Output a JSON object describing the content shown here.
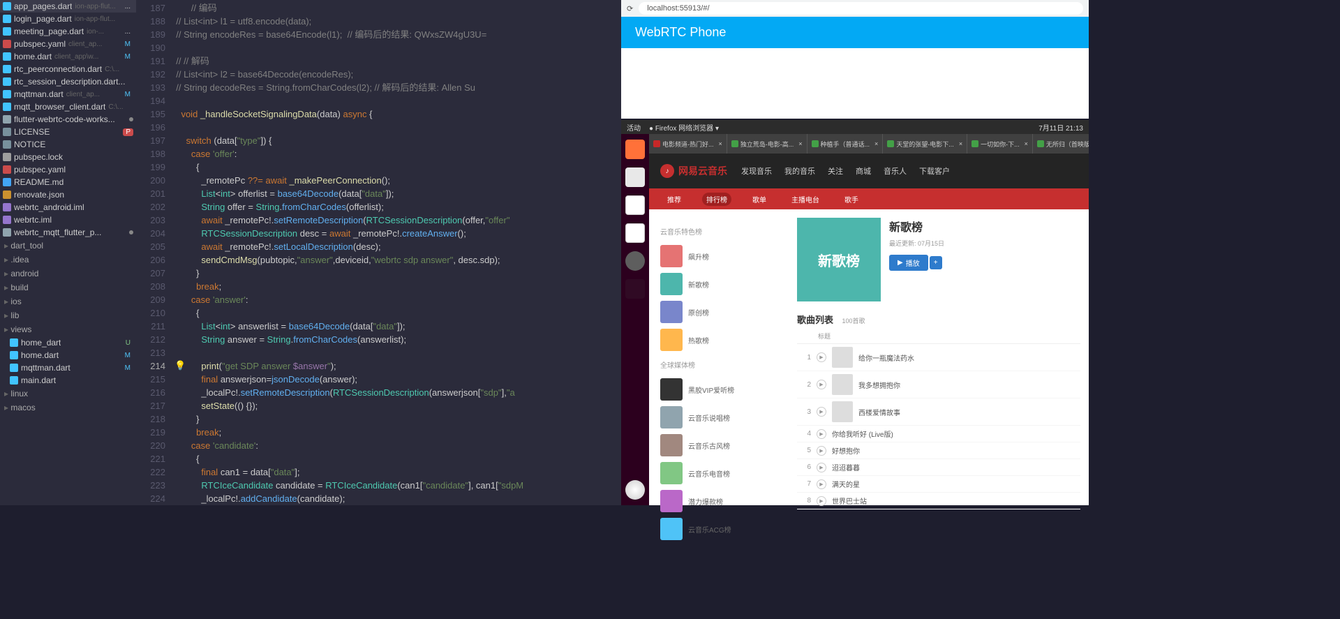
{
  "ide": {
    "files": [
      {
        "name": "app_pages.dart",
        "path": "ion-app-flut...",
        "icon": "dart",
        "badge": "..."
      },
      {
        "name": "login_page.dart",
        "path": "ion-app-flut...",
        "icon": "dart",
        "badge": ""
      },
      {
        "name": "meeting_page.dart",
        "path": "ion-...",
        "icon": "dart",
        "badge": "..."
      },
      {
        "name": "pubspec.yaml",
        "path": "client_ap...",
        "icon": "yaml",
        "badge": "M"
      },
      {
        "name": "home.dart",
        "path": "client_app\\w...",
        "icon": "dart",
        "badge": "M"
      },
      {
        "name": "rtc_peerconnection.dart",
        "path": "C:\\...",
        "icon": "dart",
        "badge": ""
      },
      {
        "name": "rtc_session_description.dart...",
        "path": "",
        "icon": "dart",
        "badge": ""
      },
      {
        "name": "mqttman.dart",
        "path": "client_ap...",
        "icon": "dart",
        "badge": "M"
      },
      {
        "name": "mqtt_browser_client.dart",
        "path": "C:\\...",
        "icon": "dart",
        "badge": ""
      }
    ],
    "project_files": [
      {
        "name": "flutter-webrtc-code-works...",
        "icon": "folder",
        "dot": true
      },
      {
        "name": "LICENSE",
        "icon": "txt",
        "badge": "P"
      },
      {
        "name": "NOTICE",
        "icon": "txt"
      },
      {
        "name": "pubspec.lock",
        "icon": "lock"
      },
      {
        "name": "pubspec.yaml",
        "icon": "yaml"
      },
      {
        "name": "README.md",
        "icon": "md"
      },
      {
        "name": "renovate.json",
        "icon": "json"
      },
      {
        "name": "webrtc_android.iml",
        "icon": "iml"
      },
      {
        "name": "webrtc.iml",
        "icon": "iml"
      },
      {
        "name": "webrtc_mqtt_flutter_p...",
        "icon": "folder",
        "dot": true
      }
    ],
    "folders": [
      "dart_tool",
      ".idea",
      "android",
      "build",
      "ios",
      "lib",
      "views"
    ],
    "lib_files": [
      {
        "name": "home_dart",
        "badge": "U"
      },
      {
        "name": "home.dart",
        "badge": "M"
      },
      {
        "name": "mqttman.dart",
        "badge": "M"
      },
      {
        "name": "main.dart",
        "badge": ""
      }
    ],
    "bottom_folders": [
      "linux",
      "macos"
    ],
    "line_start": 187,
    "highlighted_line": 214,
    "code_lines": [
      {
        "n": 187,
        "html": "        <span class='c'>// 编码</span>"
      },
      {
        "n": 188,
        "html": "  <span class='c'>// List&lt;int&gt; l1 = utf8.encode(data);</span>"
      },
      {
        "n": 189,
        "html": "  <span class='c'>// String encodeRes = base64Encode(l1);  // 编码后的结果: QWxsZW4gU3U=</span>"
      },
      {
        "n": 190,
        "html": ""
      },
      {
        "n": 191,
        "html": "  <span class='c'>// // 解码</span>"
      },
      {
        "n": 192,
        "html": "  <span class='c'>// List&lt;int&gt; l2 = base64Decode(encodeRes);</span>"
      },
      {
        "n": 193,
        "html": "  <span class='c'>// String decodeRes = String.fromCharCodes(l2); // 解码后的结果: Allen Su</span>"
      },
      {
        "n": 194,
        "html": ""
      },
      {
        "n": 195,
        "html": "    <span class='k'>void</span> <span class='fn'>_handleSocketSignalingData</span>(data) <span class='k'>async</span> {"
      },
      {
        "n": 196,
        "html": ""
      },
      {
        "n": 197,
        "html": "      <span class='k'>switch</span> (data[<span class='s'>\"type\"</span>]) {"
      },
      {
        "n": 198,
        "html": "        <span class='k'>case</span> <span class='s'>'offer'</span>:"
      },
      {
        "n": 199,
        "html": "          {"
      },
      {
        "n": 200,
        "html": "            _remotePc <span class='k'>??=</span> <span class='k'>await</span> <span class='fn'>_makePeerConnection</span>();"
      },
      {
        "n": 201,
        "html": "            <span class='t'>List</span>&lt;<span class='t'>int</span>&gt; offerlist = <span class='m'>base64Decode</span>(data[<span class='s'>\"data\"</span>]);"
      },
      {
        "n": 202,
        "html": "            <span class='t'>String</span> offer = <span class='t'>String</span>.<span class='m'>fromCharCodes</span>(offerlist);"
      },
      {
        "n": 203,
        "html": "            <span class='k'>await</span> _remotePc!.<span class='m'>setRemoteDescription</span>(<span class='t'>RTCSessionDescription</span>(offer,<span class='s'>\"offer\"</span>"
      },
      {
        "n": 204,
        "html": "            <span class='t'>RTCSessionDescription</span> desc = <span class='k'>await</span> _remotePc!.<span class='m'>createAnswer</span>();"
      },
      {
        "n": 205,
        "html": "            <span class='k'>await</span> _remotePc!.<span class='m'>setLocalDescription</span>(desc);"
      },
      {
        "n": 206,
        "html": "            <span class='fn'>sendCmdMsg</span>(pubtopic,<span class='s'>\"answer\"</span>,deviceid,<span class='s'>\"webrtc sdp answer\"</span>, desc.sdp);"
      },
      {
        "n": 207,
        "html": "          }"
      },
      {
        "n": 208,
        "html": "          <span class='k'>break</span>;"
      },
      {
        "n": 209,
        "html": "        <span class='k'>case</span> <span class='s'>'answer'</span>:"
      },
      {
        "n": 210,
        "html": "          {"
      },
      {
        "n": 211,
        "html": "            <span class='t'>List</span>&lt;<span class='t'>int</span>&gt; answerlist = <span class='m'>base64Decode</span>(data[<span class='s'>\"data\"</span>]);"
      },
      {
        "n": 212,
        "html": "            <span class='t'>String</span> answer = <span class='t'>String</span>.<span class='m'>fromCharCodes</span>(answerlist);"
      },
      {
        "n": 213,
        "html": ""
      },
      {
        "n": 214,
        "html": "            <span class='fn'>print</span>(<span class='s'>\"get SDP answer <span class='v'>$answer</span>\"</span>);"
      },
      {
        "n": 215,
        "html": "            <span class='k'>final</span> answerjson=<span class='m'>jsonDecode</span>(answer);"
      },
      {
        "n": 216,
        "html": "            _localPc!.<span class='m'>setRemoteDescription</span>(<span class='t'>RTCSessionDescription</span>(answerjson[<span class='s'>\"sdp\"</span>],<span class='s'>\"a</span>"
      },
      {
        "n": 217,
        "html": "            <span class='fn'>setState</span>(() {});"
      },
      {
        "n": 218,
        "html": "          }"
      },
      {
        "n": 219,
        "html": "          <span class='k'>break</span>;"
      },
      {
        "n": 220,
        "html": "        <span class='k'>case</span> <span class='s'>'candidate'</span>:"
      },
      {
        "n": 221,
        "html": "          {"
      },
      {
        "n": 222,
        "html": "            <span class='k'>final</span> can1 = data[<span class='s'>\"data\"</span>];"
      },
      {
        "n": 223,
        "html": "            <span class='t'>RTCIceCandidate</span> candidate = <span class='t'>RTCIceCandidate</span>(can1[<span class='s'>\"candidate\"</span>], can1[<span class='s'>\"sdpM</span>"
      },
      {
        "n": 224,
        "html": "            _localPc!.<span class='m'>addCandidate</span>(candidate);"
      }
    ]
  },
  "browser": {
    "url": "localhost:55913/#/",
    "title": "WebRTC Phone"
  },
  "gnome": {
    "activities": "活动",
    "app": "Firefox 网络浏览器",
    "time": "7月11日 21:13"
  },
  "firefox": {
    "tabs": [
      {
        "label": "电影频道-热门好...",
        "fav": "r"
      },
      {
        "label": "独立荒岛-电影-高...",
        "fav": "g"
      },
      {
        "label": "种植手（普通话...",
        "fav": "g"
      },
      {
        "label": "天堂的张望-电影下...",
        "fav": "g"
      },
      {
        "label": "一切如你-下...",
        "fav": "g"
      },
      {
        "label": "无所归（首映版...",
        "fav": "g"
      }
    ]
  },
  "music": {
    "brand": "网易云音乐",
    "nav": [
      "发现音乐",
      "我的音乐",
      "关注",
      "商城",
      "音乐人",
      "下载客户"
    ],
    "subnav": [
      "推荐",
      "排行榜",
      "歌单",
      "主播电台",
      "歌手"
    ],
    "left_section1": "云音乐特色榜",
    "playlists": [
      "飙升榜",
      "新歌榜",
      "原创榜",
      "热歌榜"
    ],
    "left_section2": "全球媒体榜",
    "playlists2": [
      "黑胶VIP爱听榜",
      "云音乐说唱榜",
      "云音乐古风榜",
      "云音乐电音榜",
      "潜力爆款榜",
      "云音乐ACG榜"
    ],
    "chart_title": "新歌榜",
    "chart_cover_text": "新歌榜",
    "chart_meta": "最近更新: 07月15日",
    "play_btn": "播放",
    "songlist_title": "歌曲列表",
    "songlist_count": "100首歌",
    "col_title": "标题",
    "songs": [
      {
        "idx": 1,
        "title": "给你一瓶魔法药水"
      },
      {
        "idx": 2,
        "title": "我多想拥抱你"
      },
      {
        "idx": 3,
        "title": "西楼爱情故事"
      },
      {
        "idx": 4,
        "title": "你给我听好 (Live版)"
      },
      {
        "idx": 5,
        "title": "好想抱你"
      },
      {
        "idx": 6,
        "title": "迢迢暮暮"
      },
      {
        "idx": 7,
        "title": "满天的星"
      },
      {
        "idx": 8,
        "title": "世界巴士站"
      }
    ]
  }
}
